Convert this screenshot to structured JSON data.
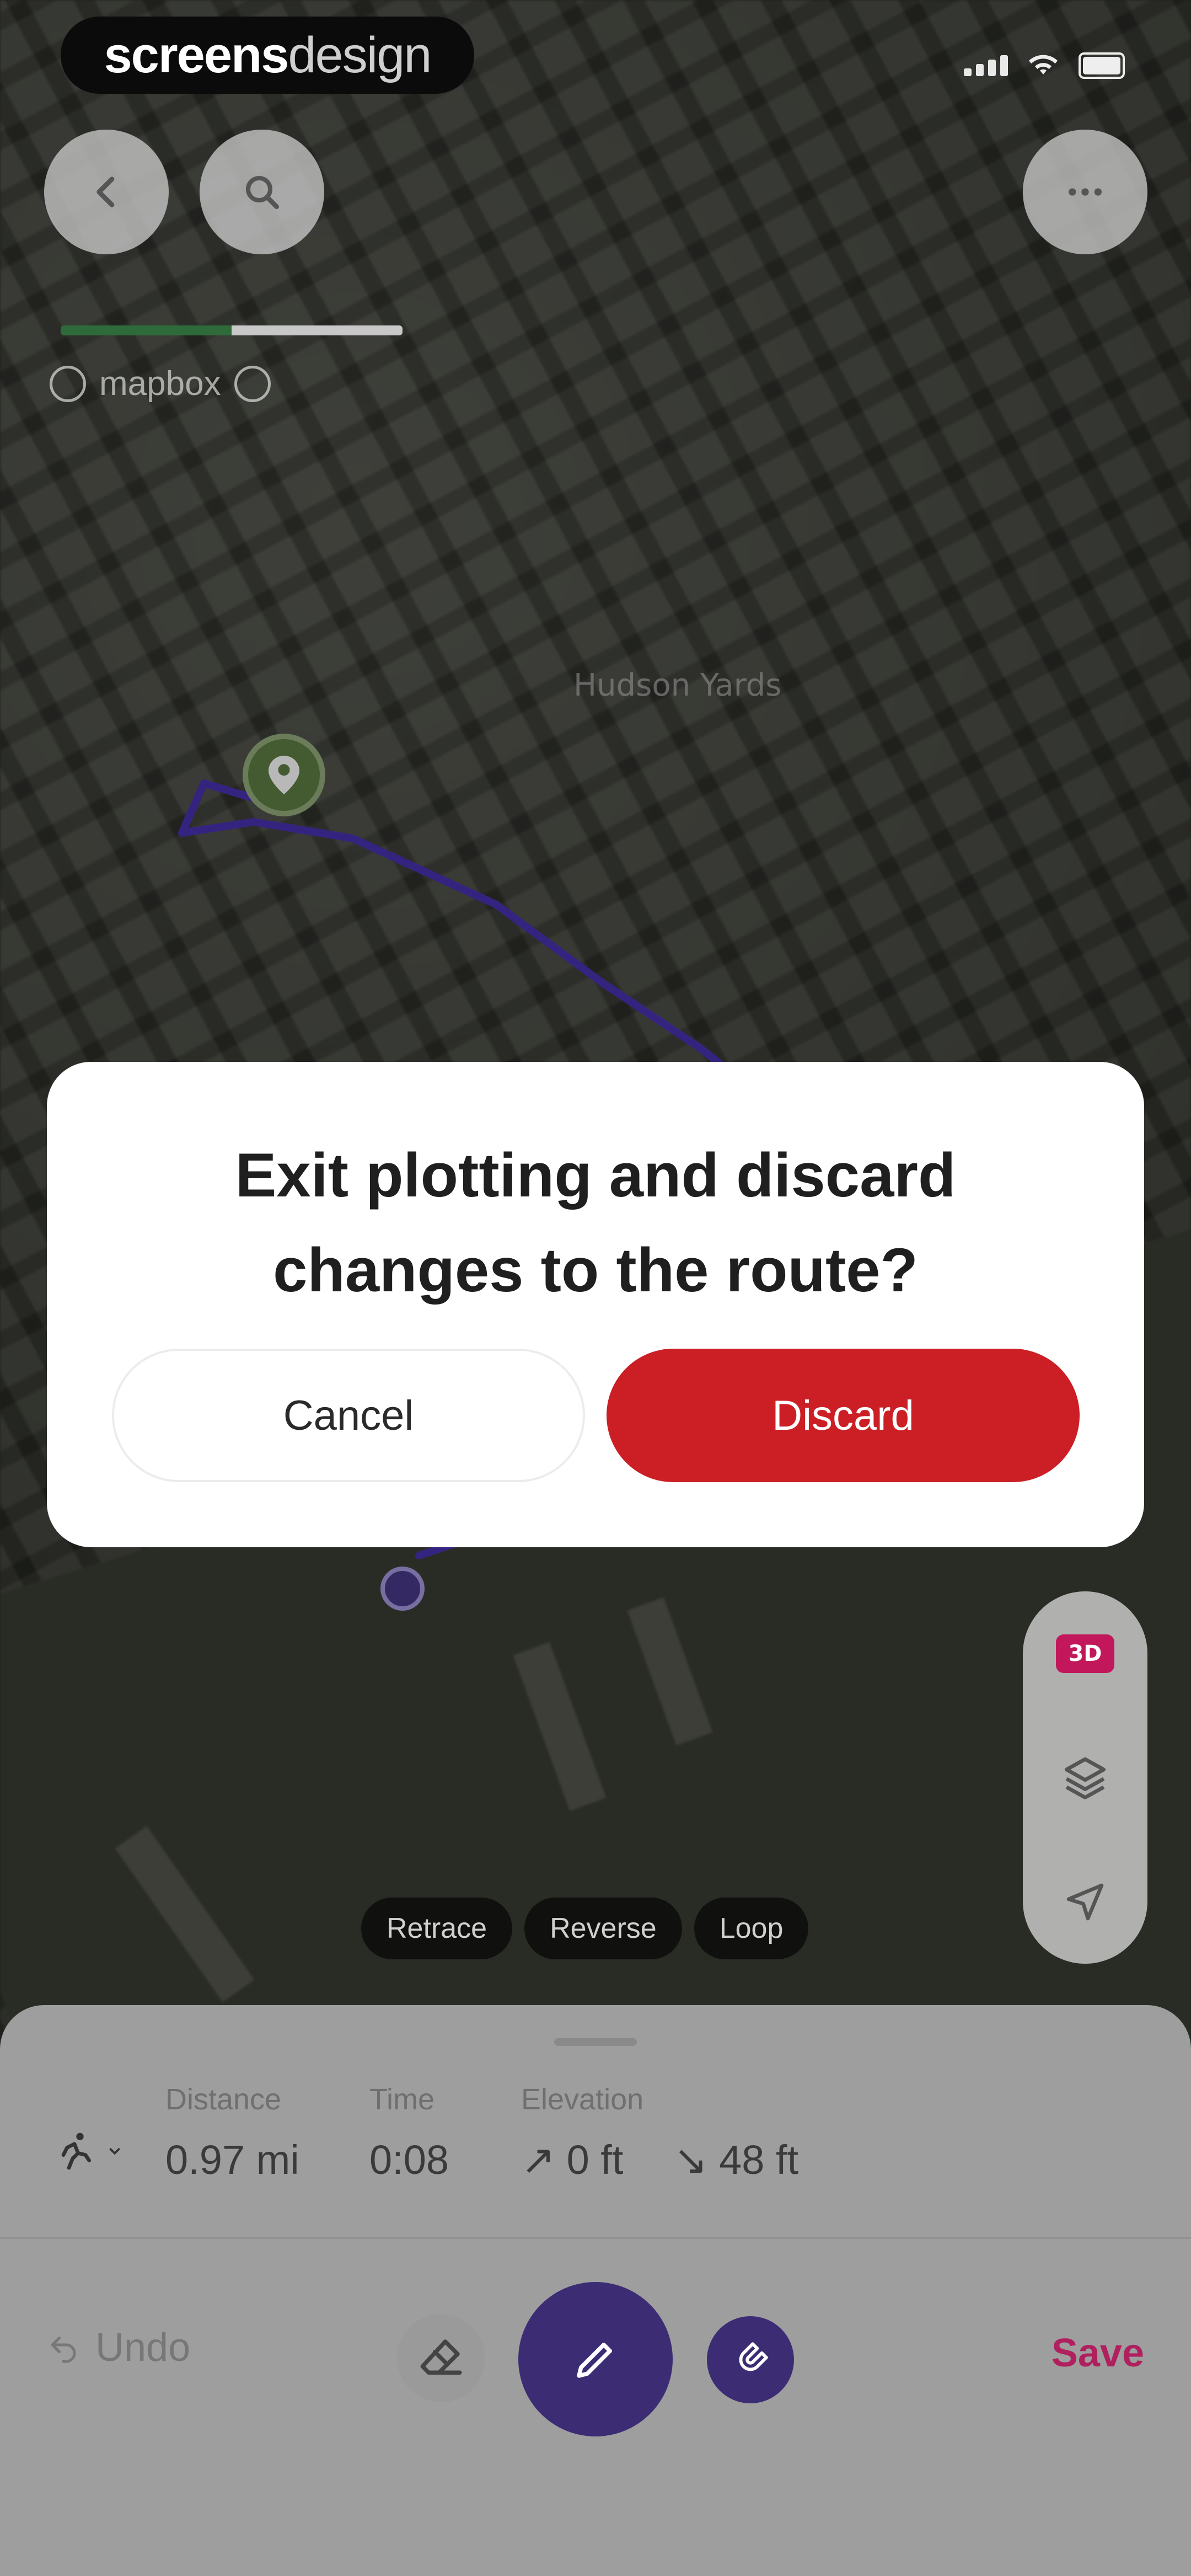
{
  "brand": {
    "part1": "screens",
    "part2": "design"
  },
  "map": {
    "attribution": "mapbox",
    "place_label": "Hudson Yards",
    "badge_3d": "3D",
    "route_color": "#4a32b0"
  },
  "chips": [
    "Retrace",
    "Reverse",
    "Loop"
  ],
  "stats": {
    "distance": {
      "label": "Distance",
      "value": "0.97 mi"
    },
    "time": {
      "label": "Time",
      "value": "0:08"
    },
    "elevation": {
      "label": "Elevation",
      "gain": "↗ 0 ft",
      "loss": "↘ 48 ft"
    }
  },
  "actions": {
    "undo": "Undo",
    "save": "Save"
  },
  "dialog": {
    "title_line1": "Exit plotting and discard",
    "title_line2": "changes to the route?",
    "cancel": "Cancel",
    "discard": "Discard"
  },
  "colors": {
    "discard": "#cc1f25",
    "accent_purple": "#3b2c74",
    "save": "#b0205e"
  }
}
